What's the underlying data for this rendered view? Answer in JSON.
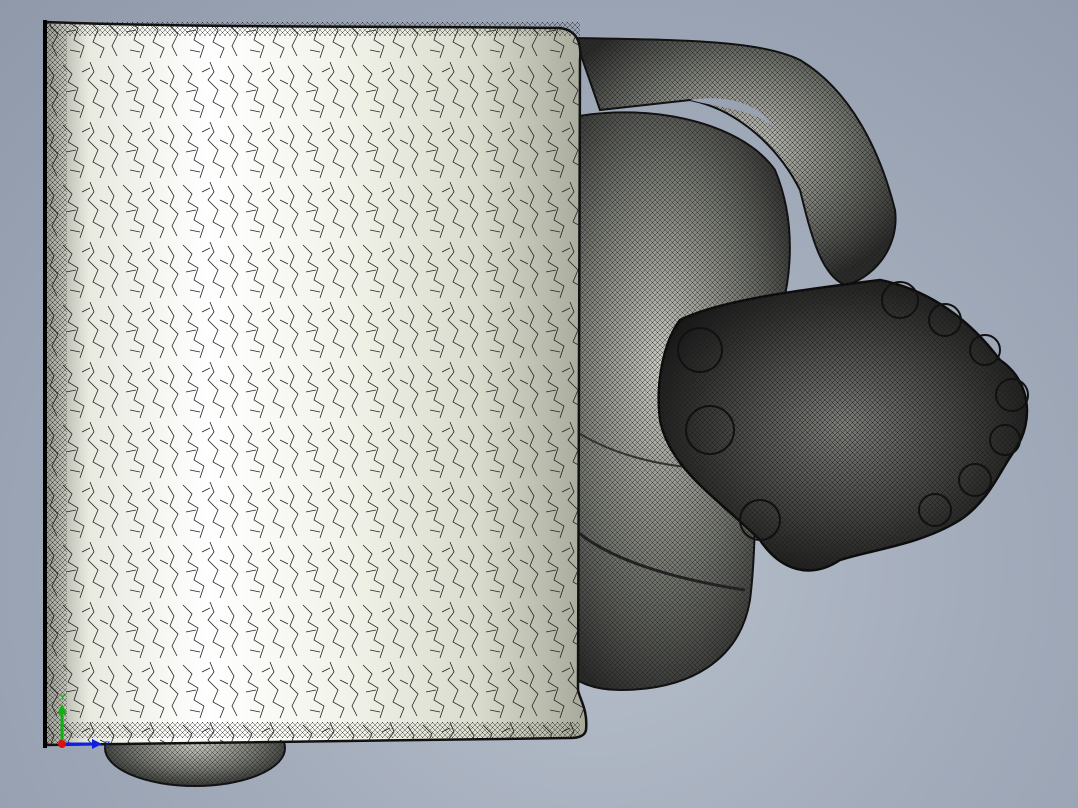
{
  "viewport": {
    "background_top": "#8f99aa",
    "background_bottom": "#b8c0cc",
    "model_surface_color": "#e6e8dc",
    "mesh_line_color": "#111111"
  },
  "triad": {
    "x_axis_label": "X",
    "y_axis_label": "Y",
    "z_axis_label": "Z",
    "x_axis_color": "#e01010",
    "y_axis_color": "#10b010",
    "z_axis_color": "#1020e0"
  }
}
